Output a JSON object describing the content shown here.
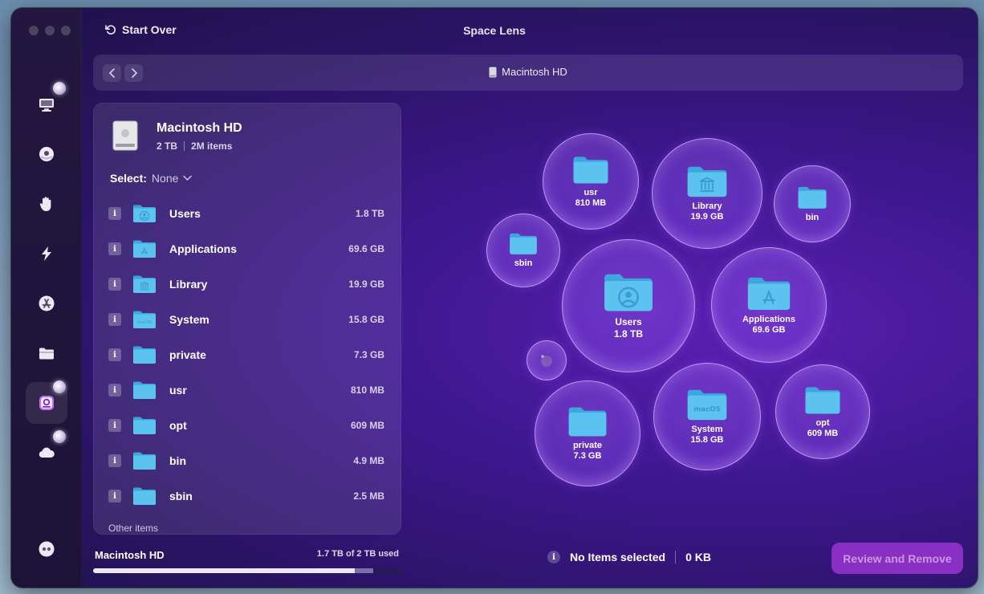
{
  "window": {
    "title": "Space Lens"
  },
  "toolbar": {
    "start_over_label": "Start Over"
  },
  "pathbar": {
    "current": "Macintosh HD"
  },
  "sidebar": {
    "items": [
      {
        "name": "cleanup",
        "icon": "monitor-clean-icon"
      },
      {
        "name": "protection",
        "icon": "shield-ball-icon"
      },
      {
        "name": "privacy",
        "icon": "hand-icon"
      },
      {
        "name": "speed",
        "icon": "lightning-icon"
      },
      {
        "name": "applications",
        "icon": "app-store-icon"
      },
      {
        "name": "clutter",
        "icon": "folder-icon"
      },
      {
        "name": "space-lens",
        "icon": "space-lens-icon",
        "active": true
      },
      {
        "name": "cloud",
        "icon": "cloud-icon"
      }
    ],
    "bottom_icon": "assistant-icon"
  },
  "panel": {
    "disk_name": "Macintosh HD",
    "capacity": "2 TB",
    "items_count": "2M items",
    "select_label": "Select:",
    "select_value": "None",
    "rows": [
      {
        "name": "Users",
        "size": "1.8 TB",
        "icon": "users-folder-icon",
        "info": "i"
      },
      {
        "name": "Applications",
        "size": "69.6 GB",
        "icon": "applications-folder-icon",
        "info": "i"
      },
      {
        "name": "Library",
        "size": "19.9 GB",
        "icon": "library-folder-icon",
        "info": "i"
      },
      {
        "name": "System",
        "size": "15.8 GB",
        "icon": "system-folder-icon",
        "info": "i"
      },
      {
        "name": "private",
        "size": "7.3 GB",
        "icon": "folder-icon",
        "info": "i"
      },
      {
        "name": "usr",
        "size": "810 MB",
        "icon": "folder-icon",
        "info": "i"
      },
      {
        "name": "opt",
        "size": "609 MB",
        "icon": "folder-icon",
        "info": "i"
      },
      {
        "name": "bin",
        "size": "4.9 MB",
        "icon": "folder-icon",
        "info": "i"
      },
      {
        "name": "sbin",
        "size": "2.5 MB",
        "icon": "folder-icon",
        "info": "i"
      }
    ],
    "cut_row": "Other items"
  },
  "footer": {
    "disk_name": "Macintosh HD",
    "used_text": "1.7 TB of 2 TB used",
    "used_fraction": 0.85,
    "pending_fraction": 0.06
  },
  "status": {
    "info": "i",
    "selected_text": "No Items selected",
    "selected_size": "0 KB",
    "review_button": "Review and Remove"
  },
  "bubbles": [
    {
      "name": "usr",
      "size": "810 MB"
    },
    {
      "name": "Library",
      "size": "19.9 GB"
    },
    {
      "name": "bin",
      "size": ""
    },
    {
      "name": "sbin",
      "size": ""
    },
    {
      "name": "Users",
      "size": "1.8 TB"
    },
    {
      "name": "Applications",
      "size": "69.6 GB"
    },
    {
      "name": "",
      "size": ""
    },
    {
      "name": "private",
      "size": "7.3 GB"
    },
    {
      "name": "System",
      "size": "15.8 GB"
    },
    {
      "name": "opt",
      "size": "609 MB"
    }
  ],
  "folder_badge_text": "macOS",
  "colors": {
    "folder": "#5cc3f0",
    "accent": "#8a2fc4",
    "bubble_border": "#dcbfff"
  }
}
